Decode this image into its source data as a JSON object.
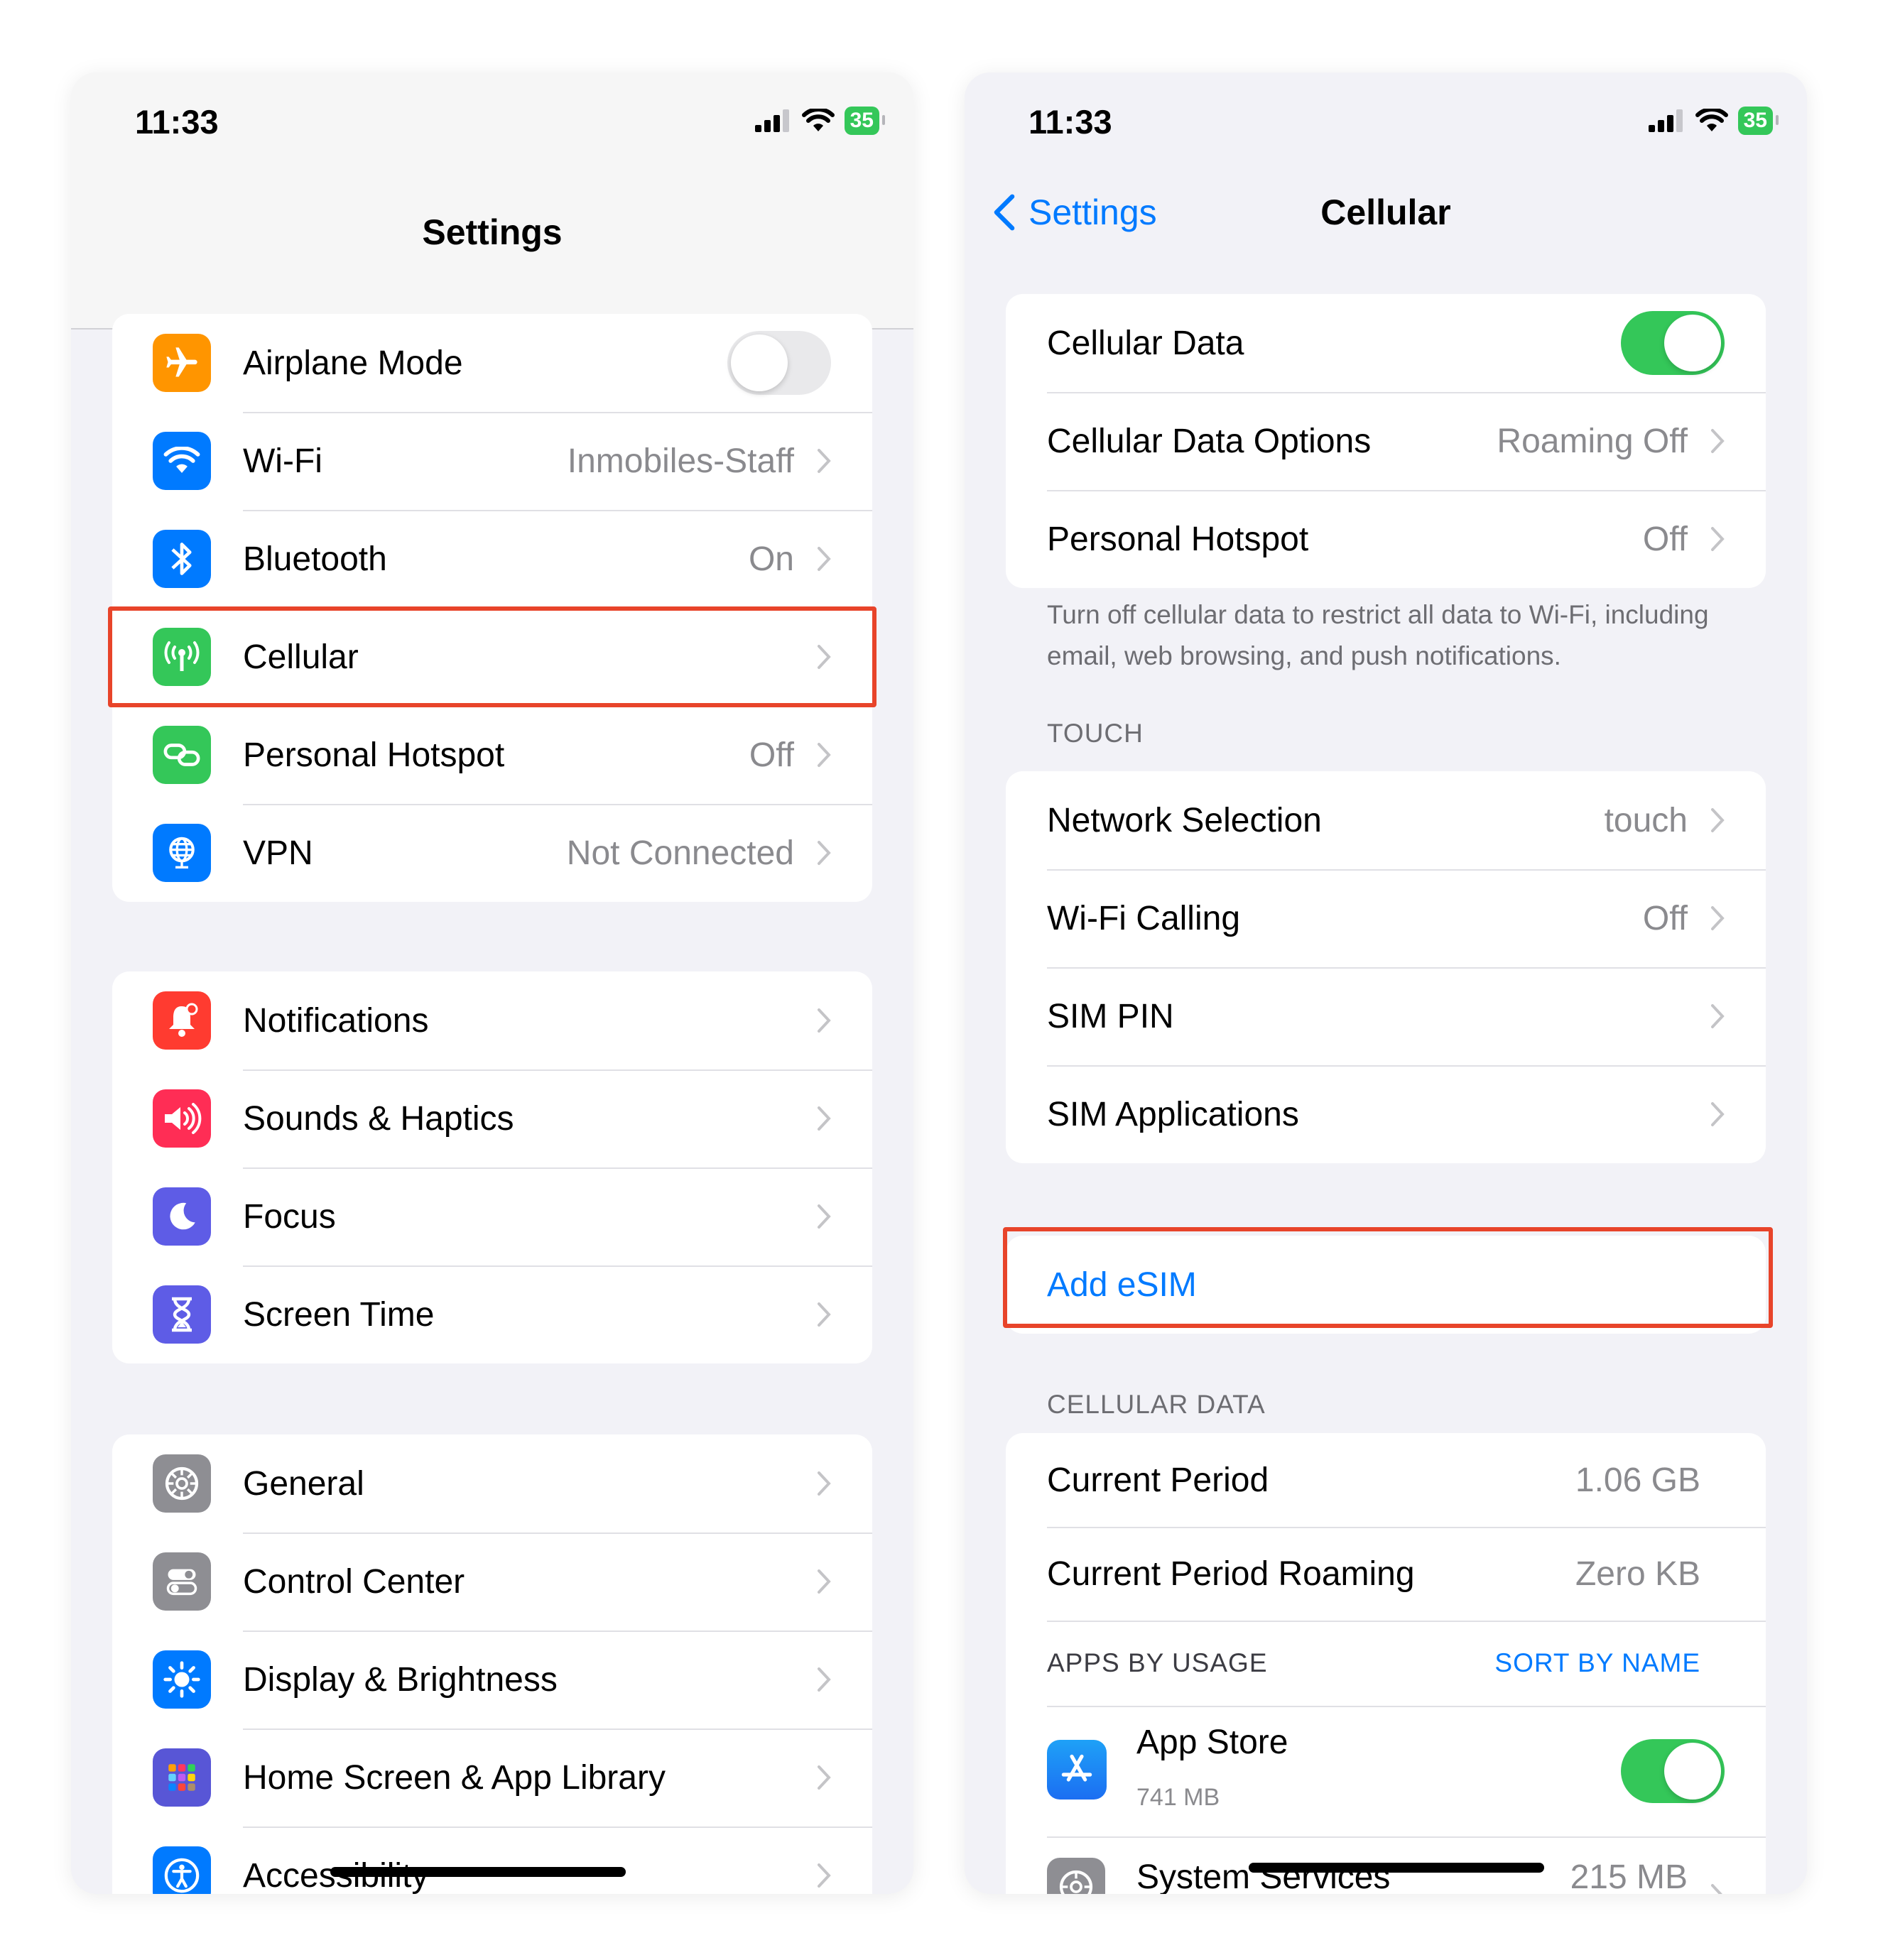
{
  "left": {
    "status": {
      "time": "11:33",
      "battery": "35"
    },
    "title": "Settings",
    "group1": [
      {
        "label": "Airplane Mode",
        "icon": "airplane-icon",
        "color": "#ff9500",
        "toggle": false
      },
      {
        "label": "Wi-Fi",
        "icon": "wifi-icon",
        "color": "#007aff",
        "value": "Inmobiles-Staff"
      },
      {
        "label": "Bluetooth",
        "icon": "bluetooth-icon",
        "color": "#007aff",
        "value": "On"
      },
      {
        "label": "Cellular",
        "icon": "cellular-antenna-icon",
        "color": "#34c759",
        "value": ""
      },
      {
        "label": "Personal Hotspot",
        "icon": "hotspot-link-icon",
        "color": "#34c759",
        "value": "Off"
      },
      {
        "label": "VPN",
        "icon": "vpn-globe-icon",
        "color": "#007aff",
        "value": "Not Connected"
      }
    ],
    "group2": [
      {
        "label": "Notifications",
        "icon": "bell-icon",
        "color": "#ff3b30"
      },
      {
        "label": "Sounds & Haptics",
        "icon": "speaker-icon",
        "color": "#ff2d55"
      },
      {
        "label": "Focus",
        "icon": "moon-icon",
        "color": "#5e5ce6"
      },
      {
        "label": "Screen Time",
        "icon": "hourglass-icon",
        "color": "#5e5ce6"
      }
    ],
    "group3": [
      {
        "label": "General",
        "icon": "gear-icon",
        "color": "#8e8e93"
      },
      {
        "label": "Control Center",
        "icon": "toggles-icon",
        "color": "#8e8e93"
      },
      {
        "label": "Display & Brightness",
        "icon": "sun-icon",
        "color": "#007aff"
      },
      {
        "label": "Home Screen & App Library",
        "icon": "app-grid-icon",
        "color": "#5856d6"
      },
      {
        "label": "Accessibility",
        "icon": "accessibility-icon",
        "color": "#007aff"
      }
    ]
  },
  "right": {
    "status": {
      "time": "11:33",
      "battery": "35"
    },
    "back_label": "Settings",
    "title": "Cellular",
    "group1": [
      {
        "label": "Cellular Data",
        "toggle": true
      },
      {
        "label": "Cellular Data Options",
        "value": "Roaming Off"
      },
      {
        "label": "Personal Hotspot",
        "value": "Off"
      }
    ],
    "footnote": "Turn off cellular data to restrict all data to Wi-Fi, including email, web browsing, and push notifications.",
    "carrier_header": "TOUCH",
    "group2": [
      {
        "label": "Network Selection",
        "value": "touch"
      },
      {
        "label": "Wi-Fi Calling",
        "value": "Off"
      },
      {
        "label": "SIM PIN",
        "value": ""
      },
      {
        "label": "SIM Applications",
        "value": ""
      }
    ],
    "add_esim": "Add eSIM",
    "data_header": "CELLULAR DATA",
    "usage": [
      {
        "label": "Current Period",
        "value": "1.06 GB"
      },
      {
        "label": "Current Period Roaming",
        "value": "Zero KB"
      }
    ],
    "apps_header": "APPS BY USAGE",
    "sort_label": "SORT BY NAME",
    "apps": [
      {
        "label": "App Store",
        "size": "741 MB",
        "icon": "app-store-icon",
        "toggle": true
      },
      {
        "label": "System Services",
        "size": "215 MB",
        "icon": "gear-icon"
      }
    ],
    "accent": "#007aff",
    "highlight_color": "#e8442a"
  }
}
